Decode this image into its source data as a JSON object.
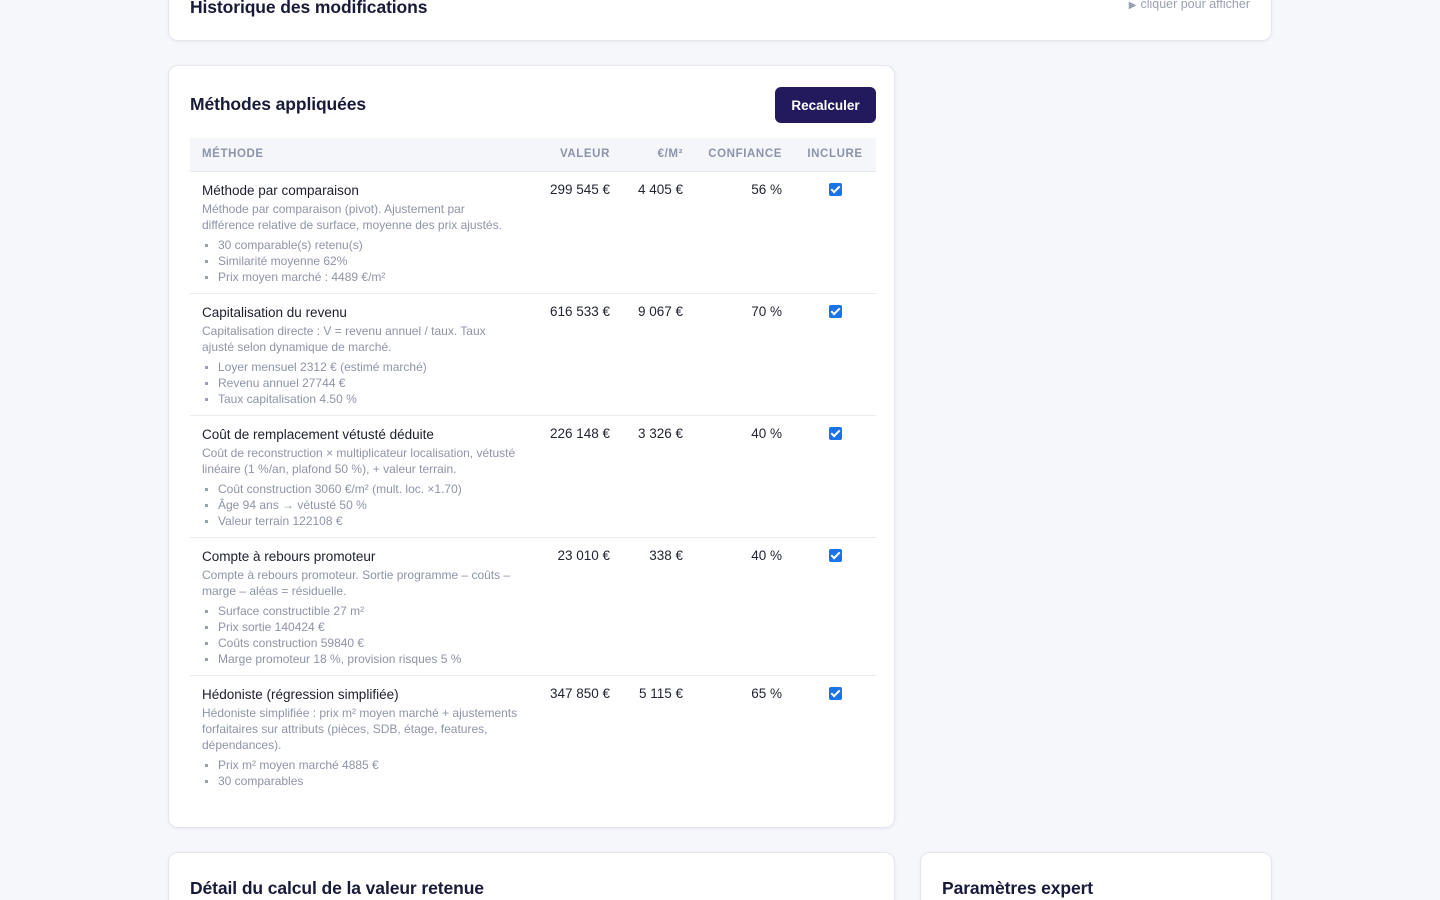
{
  "history": {
    "title": "Historique des modifications",
    "toggle_icon": "▶",
    "toggle_label": "cliquer pour afficher"
  },
  "methods_card": {
    "title": "Méthodes appliquées",
    "recalc_label": "Recalculer",
    "accent_color": "#231a5e",
    "checkbox_color": "#1a73e8",
    "columns": {
      "method": "Méthode",
      "value": "Valeur",
      "per_m2": "€/m²",
      "confidence": "Confiance",
      "include": "Inclure"
    },
    "rows": [
      {
        "name": "Méthode par comparaison",
        "description": "Méthode par comparaison (pivot). Ajustement par différence relative de surface, moyenne des prix ajustés.",
        "bullets": [
          "30 comparable(s) retenu(s)",
          "Similarité moyenne 62%",
          "Prix moyen marché : 4489 €/m²"
        ],
        "value": "299 545 €",
        "per_m2": "4 405 €",
        "confidence": "56 %",
        "included": true
      },
      {
        "name": "Capitalisation du revenu",
        "description": "Capitalisation directe : V = revenu annuel / taux. Taux ajusté selon dynamique de marché.",
        "bullets": [
          "Loyer mensuel 2312 € (estimé marché)",
          "Revenu annuel 27744 €",
          "Taux capitalisation 4.50 %"
        ],
        "value": "616 533 €",
        "per_m2": "9 067 €",
        "confidence": "70 %",
        "included": true
      },
      {
        "name": "Coût de remplacement vétusté déduite",
        "description": "Coût de reconstruction × multiplicateur localisation, vétusté linéaire (1 %/an, plafond 50 %), + valeur terrain.",
        "bullets": [
          "Coût construction 3060 €/m² (mult. loc. ×1.70)",
          "Âge 94 ans → vétusté 50 %",
          "Valeur terrain 122108 €"
        ],
        "value": "226 148 €",
        "per_m2": "3 326 €",
        "confidence": "40 %",
        "included": true
      },
      {
        "name": "Compte à rebours promoteur",
        "description": "Compte à rebours promoteur. Sortie programme – coûts – marge – aléas = résiduelle.",
        "bullets": [
          "Surface constructible 27 m²",
          "Prix sortie 140424 €",
          "Coûts construction 59840 €",
          "Marge promoteur 18 %, provision risques 5 %"
        ],
        "value": "23 010 €",
        "per_m2": "338 €",
        "confidence": "40 %",
        "included": true
      },
      {
        "name": "Hédoniste (régression simplifiée)",
        "description": "Hédoniste simplifiée : prix m² moyen marché + ajustements forfaitaires sur attributs (pièces, SDB, étage, features, dépendances).",
        "bullets": [
          "Prix m² moyen marché 4885 €",
          "30 comparables"
        ],
        "value": "347 850 €",
        "per_m2": "5 115 €",
        "confidence": "65 %",
        "included": true
      }
    ]
  },
  "detail": {
    "title": "Détail du calcul de la valeur retenue"
  },
  "expert": {
    "title": "Paramètres expert"
  }
}
